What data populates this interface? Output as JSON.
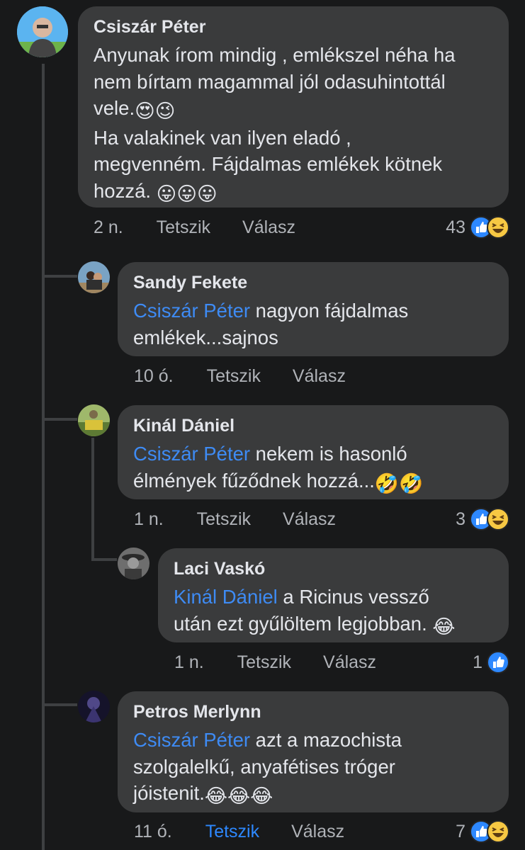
{
  "comments": [
    {
      "name": "Csiszár Péter",
      "line1": "Anyunak írom mindig , emlékszel néha ha",
      "line2": "nem bírtam magammal jól odasuhintottál",
      "line3": "vele.",
      "line3_emoji": "😍😉",
      "line4": "Ha valakinek van ilyen eladó ,",
      "line5": "megvenném. Fájdalmas emlékek kötnek",
      "line6": "hozzá. ",
      "line6_emoji": "😛😛😛",
      "time": "2 n.",
      "like": "Tetszik",
      "reply": "Válasz",
      "reaction_count": "43",
      "reaction_icons": [
        "like-icon",
        "haha-icon"
      ]
    },
    {
      "name": "Sandy Fekete",
      "mention": "Csiszár Péter",
      "line1": " nagyon fájdalmas",
      "line2": "emlékek...sajnos",
      "time": "10 ó.",
      "like": "Tetszik",
      "reply": "Válasz"
    },
    {
      "name": "Kinál Dániel",
      "mention": "Csiszár Péter",
      "line1": " nekem is hasonló",
      "line2": "élmények fűződnek hozzá...",
      "line2_emoji": "🤣🤣",
      "time": "1 n.",
      "like": "Tetszik",
      "reply": "Válasz",
      "reaction_count": "3",
      "reaction_icons": [
        "like-icon",
        "haha-icon"
      ]
    },
    {
      "name": "Laci Vaskó",
      "mention": "Kinál Dániel",
      "line1": " a Ricinus vessző",
      "line2": "után ezt gyűlöltem legjobban. ",
      "line2_emoji": "😂",
      "time": "1 n.",
      "like": "Tetszik",
      "reply": "Válasz",
      "reaction_count": "1",
      "reaction_icons": [
        "like-icon"
      ]
    },
    {
      "name": "Petros Merlynn",
      "mention": "Csiszár Péter",
      "line1": " azt a mazochista",
      "line2": "szolgalelkű, anyafétises tróger",
      "line3": "jóistenit.",
      "line3_emoji": "😂😂😂",
      "time": "11 ó.",
      "like": "Tetszik",
      "reply": "Válasz",
      "reaction_count": "7",
      "reaction_icons": [
        "like-icon",
        "haha-icon"
      ]
    }
  ],
  "colors": {
    "background": "#18191a",
    "bubble": "#3a3b3c",
    "mention": "#3e8bf4",
    "liked": "#2d88ff",
    "meta": "#b0b3b8"
  }
}
